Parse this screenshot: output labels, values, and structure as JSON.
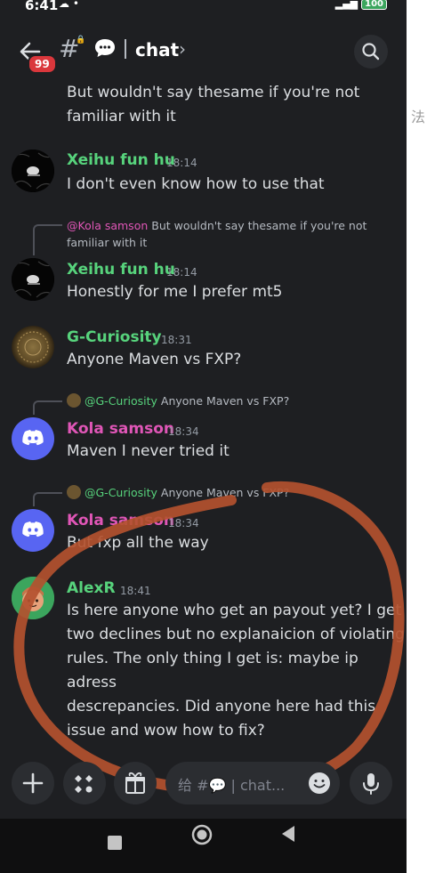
{
  "status_bar": {
    "time": "6:41",
    "icons": "☁ •",
    "battery": "100"
  },
  "header": {
    "unread_badge": "99",
    "channel_name": "chat",
    "chevron": "›"
  },
  "side_text": "法",
  "messages": [
    {
      "continuation_text": "But wouldn't say thesame if you're not\nfamiliar with it"
    },
    {
      "author": "Xeihu fun hu",
      "author_color": "#57d37c",
      "time": "18:14",
      "text": "I don't even know how to use that"
    },
    {
      "reply_to": "@Kola samson",
      "reply_text": "But wouldn't say thesame if you're not",
      "reply_text_line2": "familiar with it",
      "author": "Xeihu fun hu",
      "author_color": "#57d37c",
      "time": "18:14",
      "text": "Honestly for me I prefer mt5"
    },
    {
      "author": "G-Curiosity",
      "author_color": "#57d37c",
      "time": "18:31",
      "text": "Anyone Maven vs FXP?"
    },
    {
      "reply_to": "@G-Curiosity",
      "reply_text": "Anyone Maven vs FXP?",
      "author": "Kola samson",
      "author_color": "#e056b7",
      "time": "18:34",
      "text": "Maven I never tried it"
    },
    {
      "reply_to": "@G-Curiosity",
      "reply_text": "Anyone Maven vs FXP?",
      "author": "Kola samson",
      "author_color": "#e056b7",
      "time": "18:34",
      "text": "But fxp all the way"
    },
    {
      "author": "AlexR",
      "author_color": "#57d37c",
      "time": "18:41",
      "text": "Is here anyone who get an payout yet? I get\ntwo declines but no explanaicion of violating\nrules. The only thing I get is: maybe ip adress\ndescrepancies. Did anyone here had this\nissue and wow how to fix?"
    }
  ],
  "composer": {
    "placeholder": "给 #💬 | chat..."
  },
  "colors": {
    "background": "#1e1f22",
    "annotation": "#b3512f",
    "green_role": "#57d37c",
    "pink_role": "#e056b7",
    "discord_blurple": "#5865f2"
  }
}
